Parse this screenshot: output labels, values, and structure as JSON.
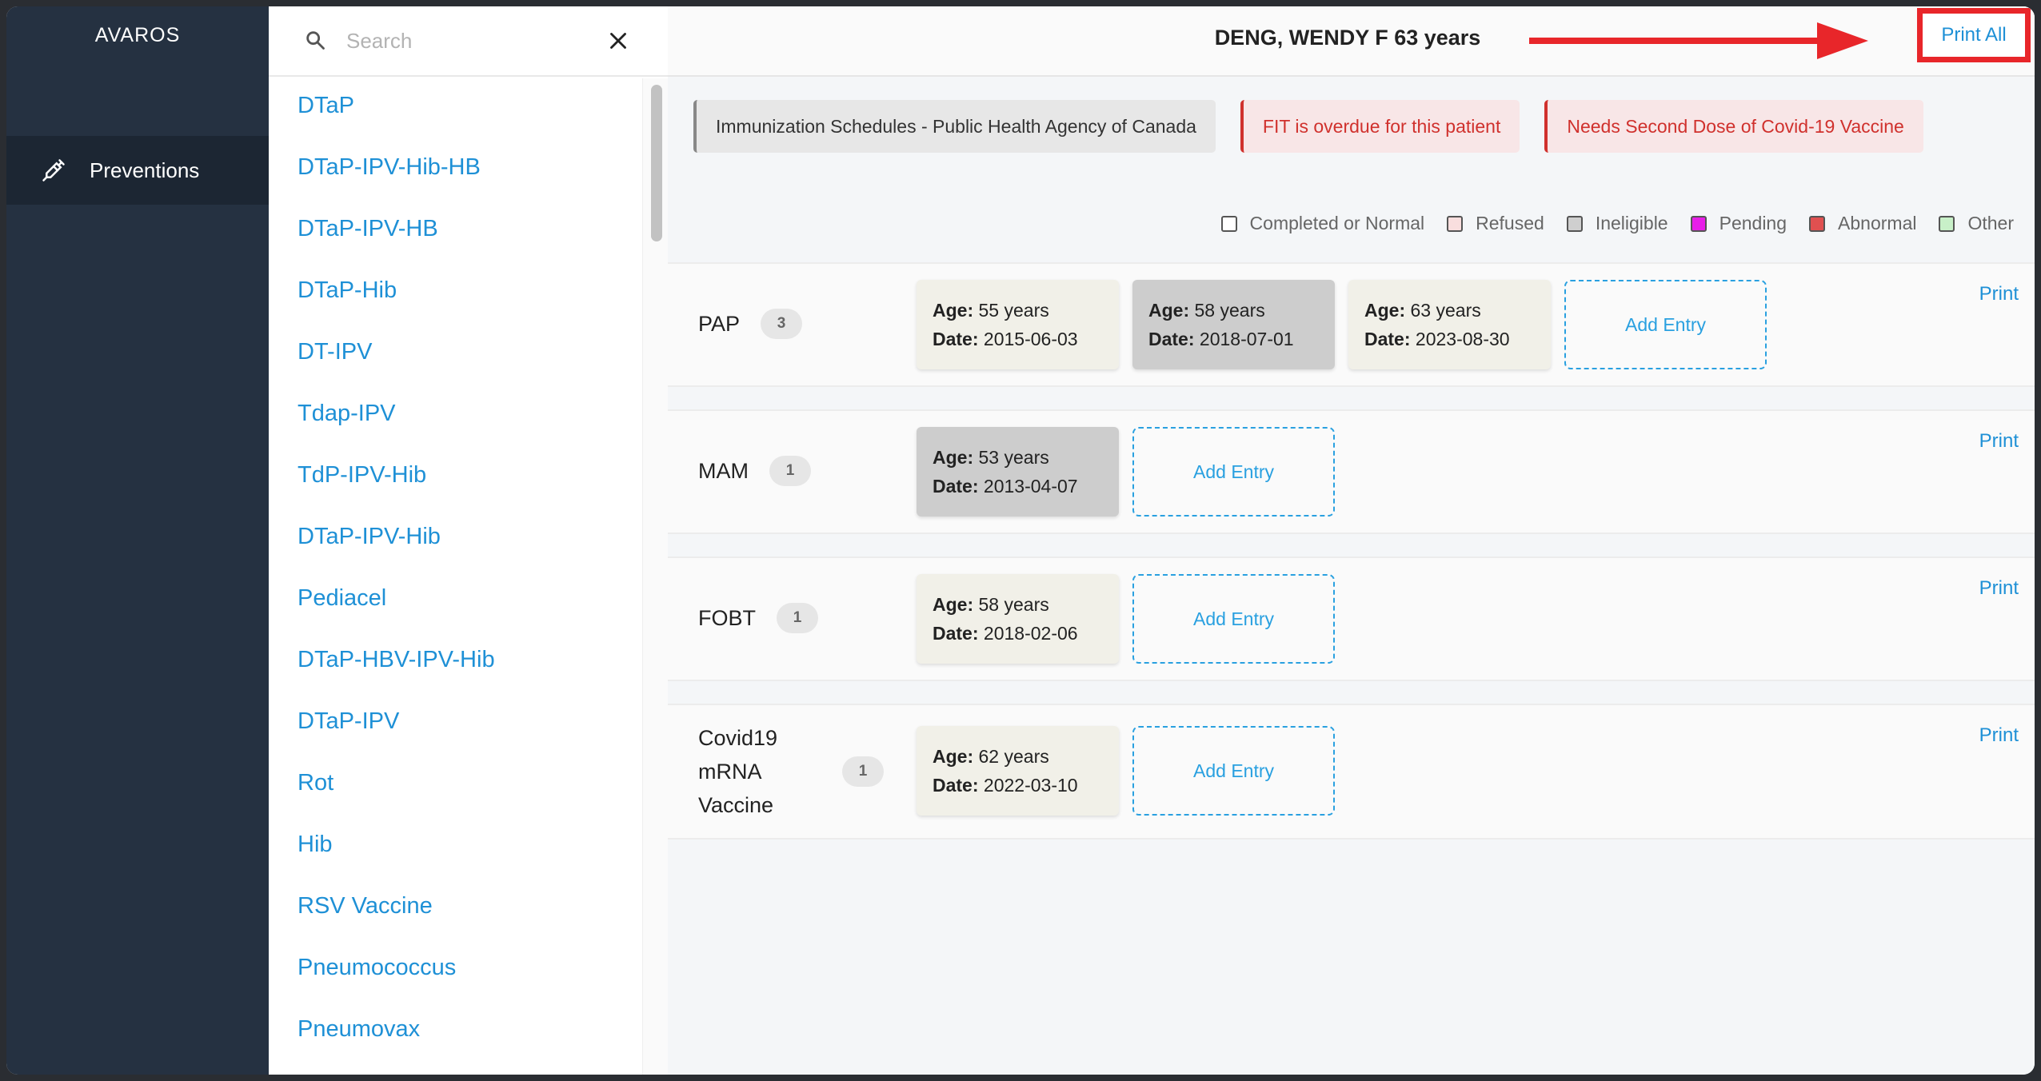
{
  "app": {
    "brand": "AVAROS"
  },
  "nav": {
    "items": [
      {
        "label": "Preventions",
        "icon": "syringe-icon"
      }
    ]
  },
  "search": {
    "placeholder": "Search",
    "value": ""
  },
  "prevention_list": [
    "DTaP",
    "DTaP-IPV-Hib-HB",
    "DTaP-IPV-HB",
    "DTaP-Hib",
    "DT-IPV",
    "Tdap-IPV",
    "TdP-IPV-Hib",
    "DTaP-IPV-Hib",
    "Pediacel",
    "DTaP-HBV-IPV-Hib",
    "DTaP-IPV",
    "Rot",
    "Hib",
    "RSV Vaccine",
    "Pneumococcus",
    "Pneumovax"
  ],
  "header": {
    "patient": "DENG, WENDY F 63 years",
    "print_all": "Print All"
  },
  "alerts": [
    {
      "text": "Immunization Schedules - Public Health Agency of Canada",
      "type": "info"
    },
    {
      "text": "FIT is overdue for this patient",
      "type": "warning"
    },
    {
      "text": "Needs Second Dose of Covid-19 Vaccine",
      "type": "warning"
    }
  ],
  "legend": [
    {
      "label": "Completed or Normal",
      "color": "#ffffff"
    },
    {
      "label": "Refused",
      "color": "#f9dede"
    },
    {
      "label": "Ineligible",
      "color": "#cfcfcf"
    },
    {
      "label": "Pending",
      "color": "#e81ee8"
    },
    {
      "label": "Abnormal",
      "color": "#e05050"
    },
    {
      "label": "Other",
      "color": "#c8f0c8"
    }
  ],
  "labels": {
    "age": "Age:",
    "date": "Date:",
    "add_entry": "Add Entry",
    "print": "Print"
  },
  "preventions": [
    {
      "name": "PAP",
      "count": "3",
      "entries": [
        {
          "age": "55 years",
          "date": "2015-06-03",
          "status": "normal"
        },
        {
          "age": "58 years",
          "date": "2018-07-01",
          "status": "ineligible"
        },
        {
          "age": "63 years",
          "date": "2023-08-30",
          "status": "normal"
        }
      ]
    },
    {
      "name": "MAM",
      "count": "1",
      "entries": [
        {
          "age": "53 years",
          "date": "2013-04-07",
          "status": "ineligible"
        }
      ]
    },
    {
      "name": "FOBT",
      "count": "1",
      "entries": [
        {
          "age": "58 years",
          "date": "2018-02-06",
          "status": "normal"
        }
      ]
    },
    {
      "name": "Covid19 mRNA Vaccine",
      "name_lines": [
        "Covid19",
        "mRNA",
        "Vaccine"
      ],
      "count": "1",
      "entries": [
        {
          "age": "62 years",
          "date": "2022-03-10",
          "status": "normal"
        }
      ]
    }
  ],
  "annotation": {
    "arrow_color": "#e8262a",
    "box_color": "#e8262a"
  }
}
